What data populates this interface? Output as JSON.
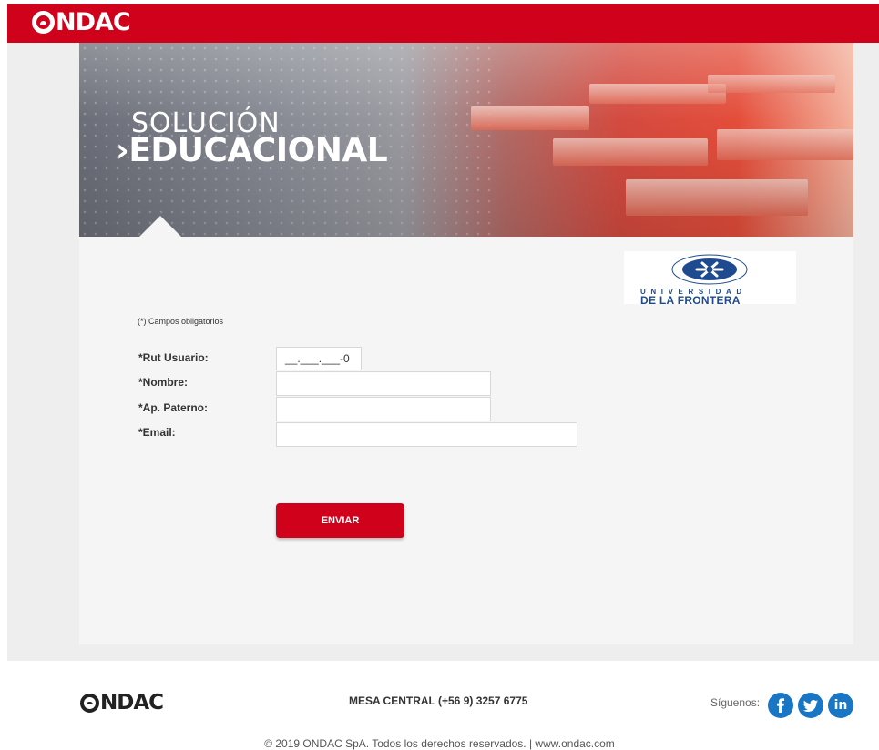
{
  "header": {
    "brand": "NDAC"
  },
  "hero": {
    "line1": "SOLUCIÓN",
    "line2": "›EDUCACIONAL"
  },
  "university_logo": {
    "line1": "UNIVERSIDAD",
    "line2": "DE LA FRONTERA"
  },
  "form": {
    "required_note": "(*) Campos obligatorios",
    "fields": [
      {
        "label": "*Rut Usuario:",
        "value": "__.___.___-0"
      },
      {
        "label": "*Nombre:",
        "value": ""
      },
      {
        "label": "*Ap. Paterno:",
        "value": ""
      },
      {
        "label": "*Email:",
        "value": ""
      }
    ],
    "submit_label": "ENVIAR"
  },
  "footer": {
    "brand": "NDAC",
    "phone": "MESA CENTRAL (+56 9) 3257 6775",
    "follow_label": "Síguenos:",
    "social": [
      "facebook-icon",
      "twitter-icon",
      "linkedin-icon"
    ],
    "copyright": "© 2019 ONDAC SpA. Todos los derechos reservados. | www.ondac.com"
  },
  "colors": {
    "brand_red": "#d0021b",
    "social_blue": "#1976c5",
    "uni_blue": "#1e4a8f"
  }
}
